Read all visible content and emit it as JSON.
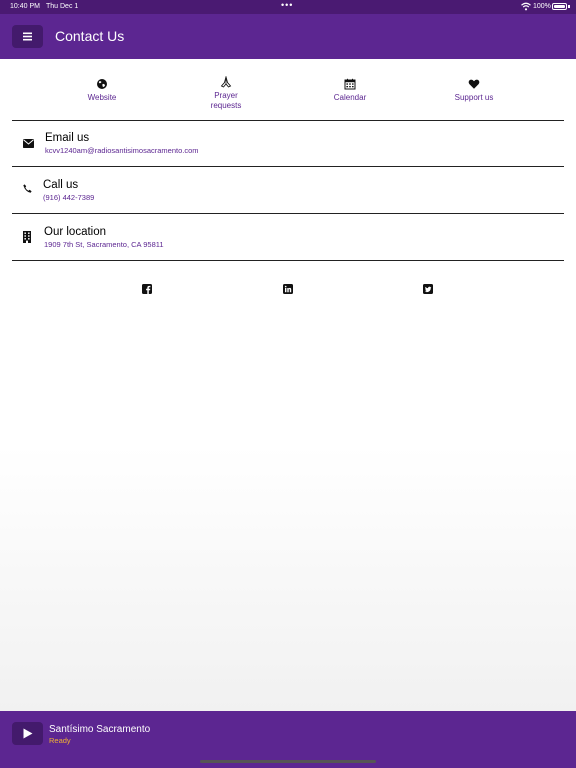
{
  "status_bar": {
    "time": "10:40 PM",
    "date": "Thu Dec 1",
    "battery": "100%"
  },
  "header": {
    "title": "Contact Us",
    "menu_icon": "hamburger-menu-icon",
    "background_color": "#5c2691"
  },
  "quick_links": [
    {
      "label": "Website",
      "icon": "globe-icon"
    },
    {
      "label": "Prayer requests",
      "icon": "praying-hands-icon"
    },
    {
      "label": "Calendar",
      "icon": "calendar-icon"
    },
    {
      "label": "Support us",
      "icon": "heart-icon"
    }
  ],
  "contacts": [
    {
      "title": "Email us",
      "value": "kcvv1240am@radiosantisimosacramento.com",
      "icon": "envelope-icon"
    },
    {
      "title": "Call us",
      "value": "(916) 442-7389",
      "icon": "phone-icon"
    },
    {
      "title": "Our location",
      "value": "1909 7th St, Sacramento, CA 95811",
      "icon": "building-icon"
    }
  ],
  "social": [
    {
      "icon": "facebook-icon"
    },
    {
      "icon": "linkedin-icon"
    },
    {
      "icon": "twitter-icon"
    }
  ],
  "player": {
    "title": "Santísimo Sacramento",
    "status": "Ready",
    "play_icon": "play-icon",
    "status_color": "#f2b233"
  }
}
